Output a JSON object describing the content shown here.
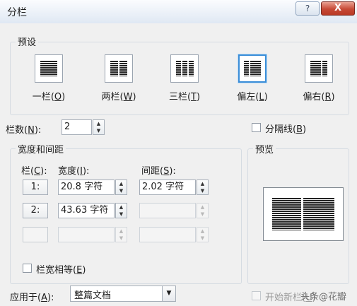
{
  "window": {
    "title": "分栏",
    "help_label": "?",
    "close_label": "X"
  },
  "presets": {
    "group_label": "预设",
    "items": [
      {
        "label": "一栏",
        "key": "O"
      },
      {
        "label": "两栏",
        "key": "W"
      },
      {
        "label": "三栏",
        "key": "T"
      },
      {
        "label": "偏左",
        "key": "L"
      },
      {
        "label": "偏右",
        "key": "R"
      }
    ],
    "selected": "偏左"
  },
  "columns_count": {
    "label": "栏数",
    "key": "N",
    "value": "2"
  },
  "divider": {
    "label": "分隔线",
    "key": "B",
    "checked": false
  },
  "width_spacing": {
    "group_label": "宽度和间距",
    "col_header": "栏",
    "col_key": "C",
    "width_header": "宽度",
    "width_key": "I",
    "spacing_header": "间距",
    "spacing_key": "S",
    "rows": [
      {
        "num": "1:",
        "width": "20.8 字符",
        "spacing": "2.02 字符"
      },
      {
        "num": "2:",
        "width": "43.63 字符",
        "spacing": ""
      },
      {
        "num": "",
        "width": "",
        "spacing": ""
      }
    ],
    "equal_width_label": "栏宽相等",
    "equal_width_key": "E",
    "equal_width_checked": false
  },
  "preview": {
    "label": "预览"
  },
  "apply_to": {
    "label": "应用于",
    "key": "A",
    "value": "整篇文档"
  },
  "new_column": {
    "label": "开始新栏",
    "key": "U",
    "enabled": false
  },
  "watermark": "头条@花瓣"
}
